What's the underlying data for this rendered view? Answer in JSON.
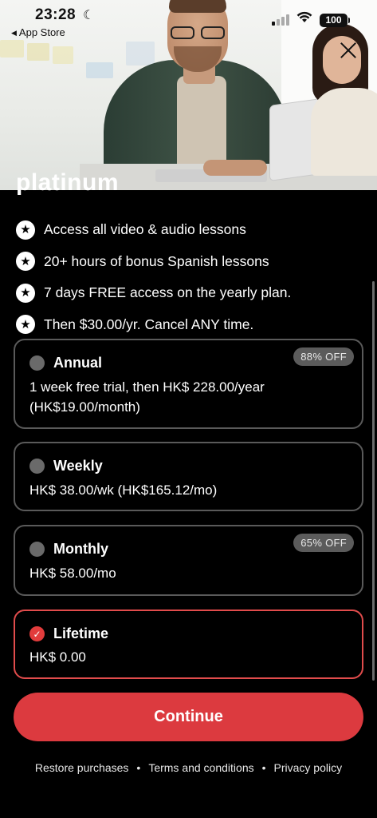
{
  "status_bar": {
    "time": "23:28",
    "back_label": "App Store",
    "battery": "100"
  },
  "hero": {
    "close_icon": "close-icon"
  },
  "heading": "platinum",
  "features": [
    "Access all video & audio lessons",
    "20+ hours of bonus Spanish lessons",
    "7 days FREE access on the yearly plan.",
    "Then $30.00/yr. Cancel ANY time."
  ],
  "plans": [
    {
      "title": "Annual",
      "desc_line1": "1 week free trial, then HK$ 228.00/year",
      "desc_line2": "(HK$19.00/month)",
      "badge": "88% OFF",
      "selected": false
    },
    {
      "title": "Weekly",
      "desc_line1": "HK$ 38.00/wk (HK$165.12/mo)",
      "selected": false
    },
    {
      "title": "Monthly",
      "desc_line1": "HK$ 58.00/mo",
      "badge": "65% OFF",
      "selected": false
    },
    {
      "title": "Lifetime",
      "desc_line1": "HK$ 0.00",
      "selected": true
    }
  ],
  "continue_label": "Continue",
  "footer": {
    "restore": "Restore purchases",
    "terms": "Terms and conditions",
    "privacy": "Privacy policy"
  },
  "colors": {
    "accent": "#dc3a3f",
    "background": "#000000",
    "card_border": "#5a5a5a"
  }
}
